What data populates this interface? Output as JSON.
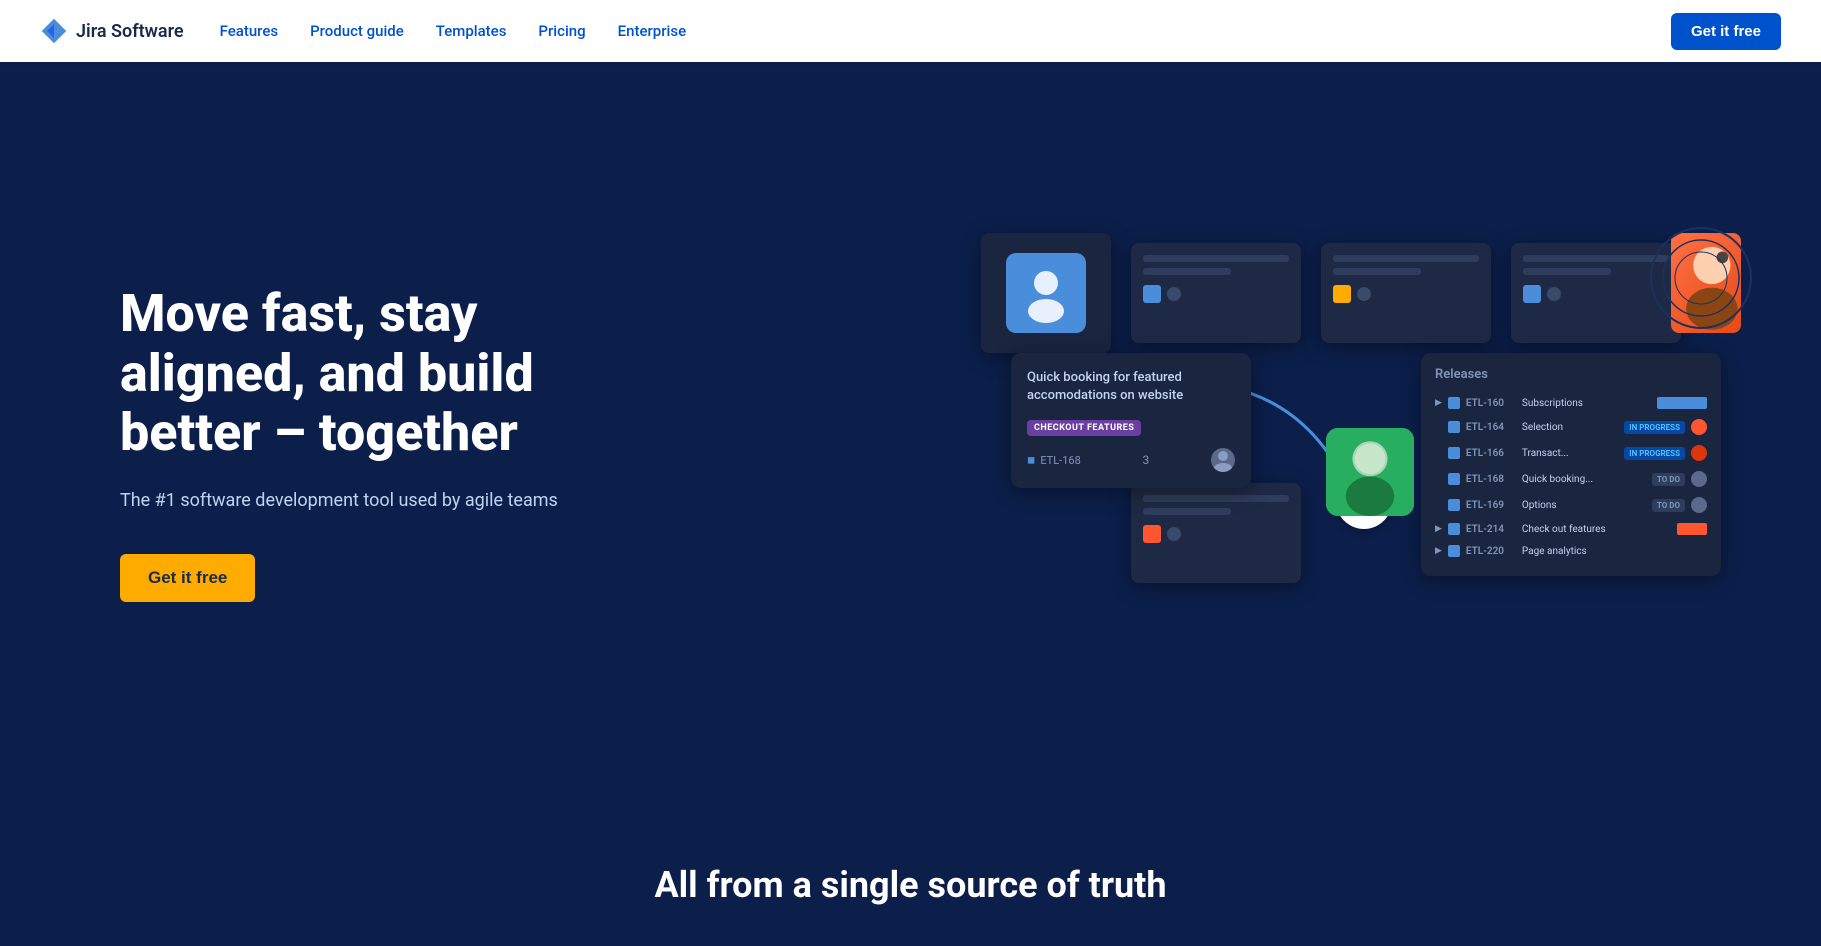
{
  "nav": {
    "logo_text": "Jira Software",
    "links": [
      {
        "id": "features",
        "label": "Features"
      },
      {
        "id": "product-guide",
        "label": "Product guide"
      },
      {
        "id": "templates",
        "label": "Templates"
      },
      {
        "id": "pricing",
        "label": "Pricing"
      },
      {
        "id": "enterprise",
        "label": "Enterprise"
      }
    ],
    "cta_label": "Get it free"
  },
  "hero": {
    "title": "Move fast, stay aligned, and build better – together",
    "subtitle": "The #1 software development tool used by agile teams",
    "cta_label": "Get it free"
  },
  "illustration": {
    "main_card": {
      "title": "Quick booking for featured accomodations on website",
      "badge": "CHECKOUT FEATURES",
      "id": "ETL-168",
      "count": "3"
    },
    "releases": {
      "title": "Releases",
      "items": [
        {
          "id": "ETL-160",
          "name": "Subscriptions",
          "status": "",
          "has_accent": true
        },
        {
          "id": "ETL-164",
          "name": "Selection",
          "status": "IN PROGRESS",
          "status_type": "in-progress"
        },
        {
          "id": "ETL-166",
          "name": "Transact...",
          "status": "IN PROGRESS",
          "status_type": "in-progress"
        },
        {
          "id": "ETL-168",
          "name": "Quick booking...",
          "status": "TO DO",
          "status_type": "todo"
        },
        {
          "id": "ETL-169",
          "name": "Options",
          "status": "TO DO",
          "status_type": "todo"
        },
        {
          "id": "ETL-214",
          "name": "Check out features",
          "status": "",
          "status_type": ""
        },
        {
          "id": "ETL-220",
          "name": "Page analytics",
          "status": "",
          "status_type": ""
        }
      ]
    }
  },
  "bottom": {
    "title": "All from a single source of truth"
  }
}
